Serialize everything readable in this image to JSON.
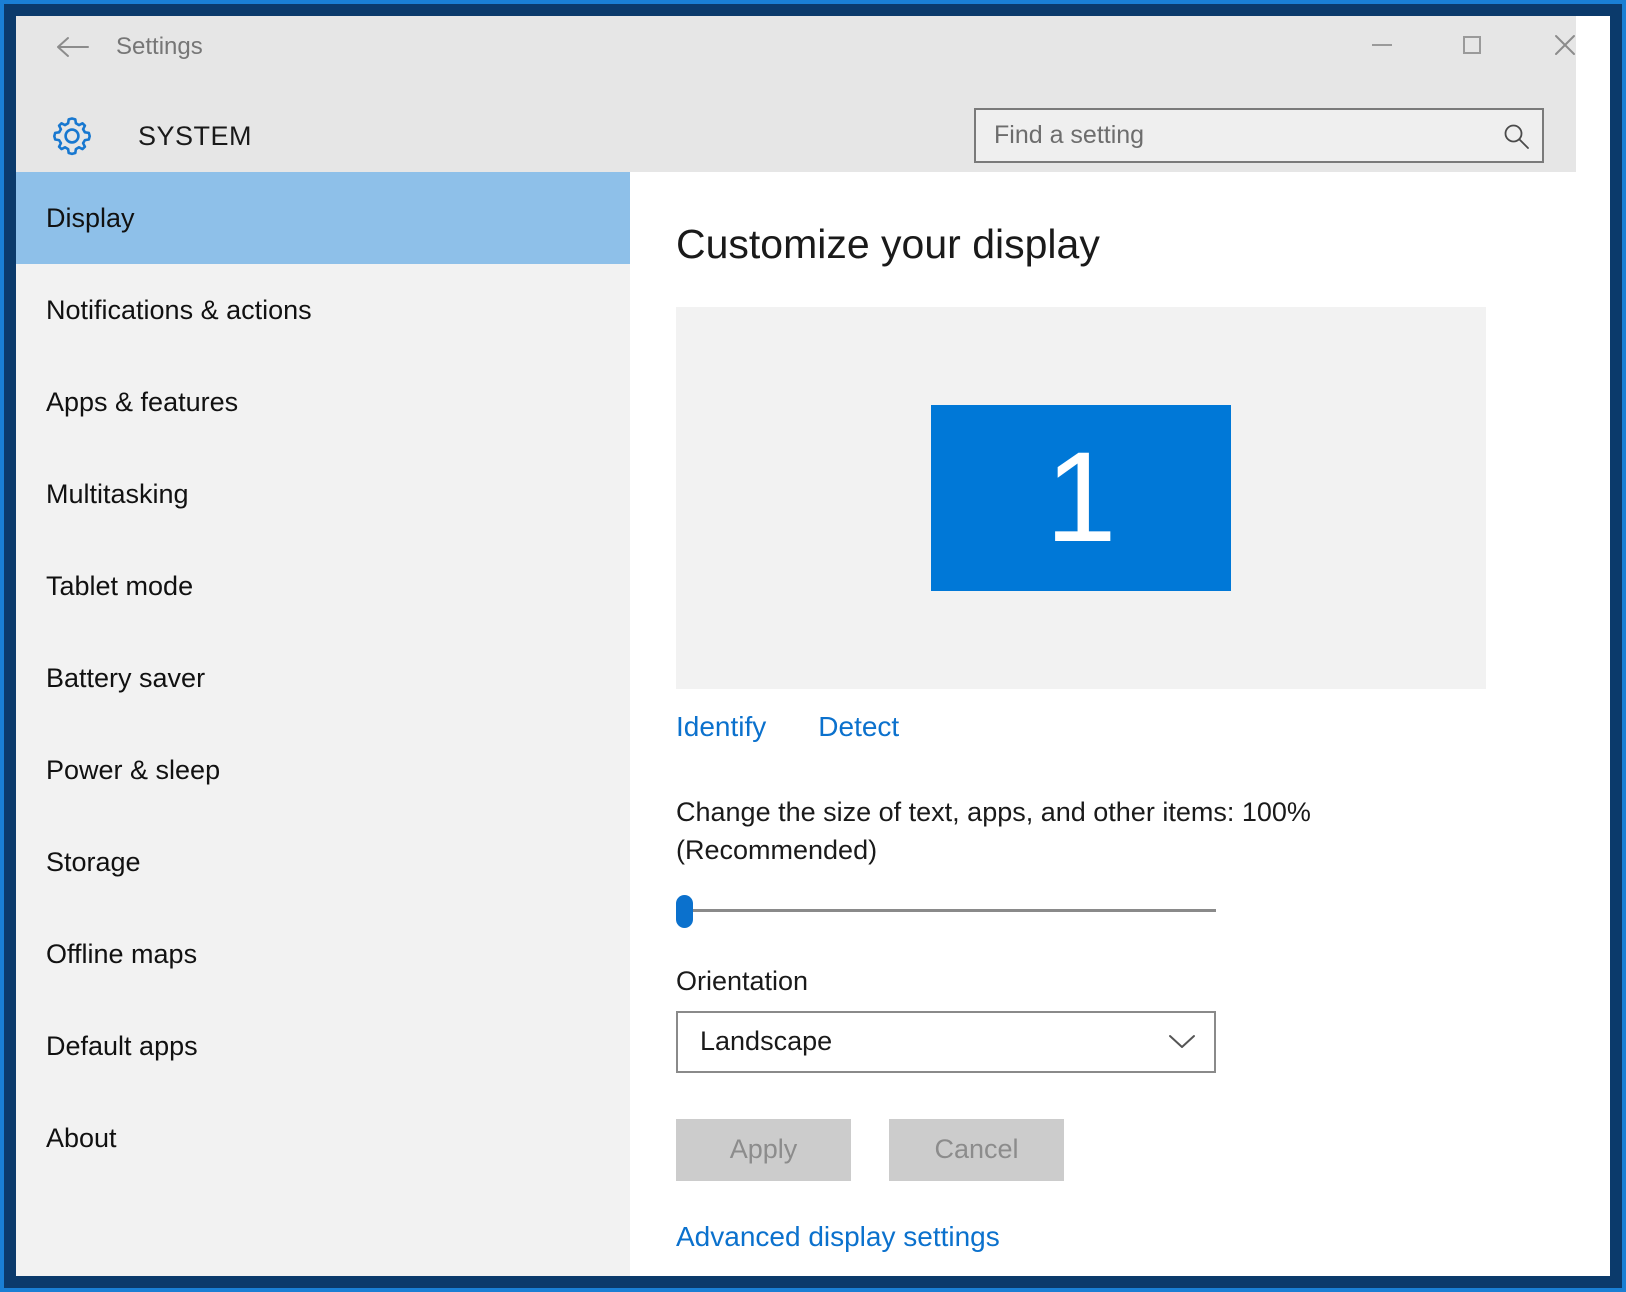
{
  "window": {
    "title": "Settings",
    "back_icon": "back-arrow-icon",
    "controls": {
      "minimize": "minimize-icon",
      "maximize": "maximize-icon",
      "close": "close-icon"
    }
  },
  "header": {
    "icon": "gear-icon",
    "category": "SYSTEM"
  },
  "search": {
    "value": "",
    "placeholder": "Find a setting",
    "icon": "search-icon"
  },
  "sidebar": {
    "selected_index": 0,
    "items": [
      {
        "label": "Display"
      },
      {
        "label": "Notifications & actions"
      },
      {
        "label": "Apps & features"
      },
      {
        "label": "Multitasking"
      },
      {
        "label": "Tablet mode"
      },
      {
        "label": "Battery saver"
      },
      {
        "label": "Power & sleep"
      },
      {
        "label": "Storage"
      },
      {
        "label": "Offline maps"
      },
      {
        "label": "Default apps"
      },
      {
        "label": "About"
      }
    ]
  },
  "main": {
    "title": "Customize your display",
    "monitor": {
      "number": "1"
    },
    "identify_label": "Identify",
    "detect_label": "Detect",
    "scale_label": "Change the size of text, apps, and other items: 100% (Recommended)",
    "scale_percent": 100,
    "slider": {
      "value": 0,
      "min": 0,
      "max": 100
    },
    "orientation_label": "Orientation",
    "orientation_value": "Landscape",
    "orientation_chevron": "chevron-down-icon",
    "apply_label": "Apply",
    "cancel_label": "Cancel",
    "advanced_link": "Advanced display settings"
  },
  "colors": {
    "accent": "#0078d7",
    "link": "#0b71cd",
    "selection": "#8ec0e9",
    "chrome": "#e6e6e6",
    "sidebar": "#f2f2f2",
    "frame_navy": "#0b3a6b",
    "frame_blue": "#1a7fd4"
  }
}
